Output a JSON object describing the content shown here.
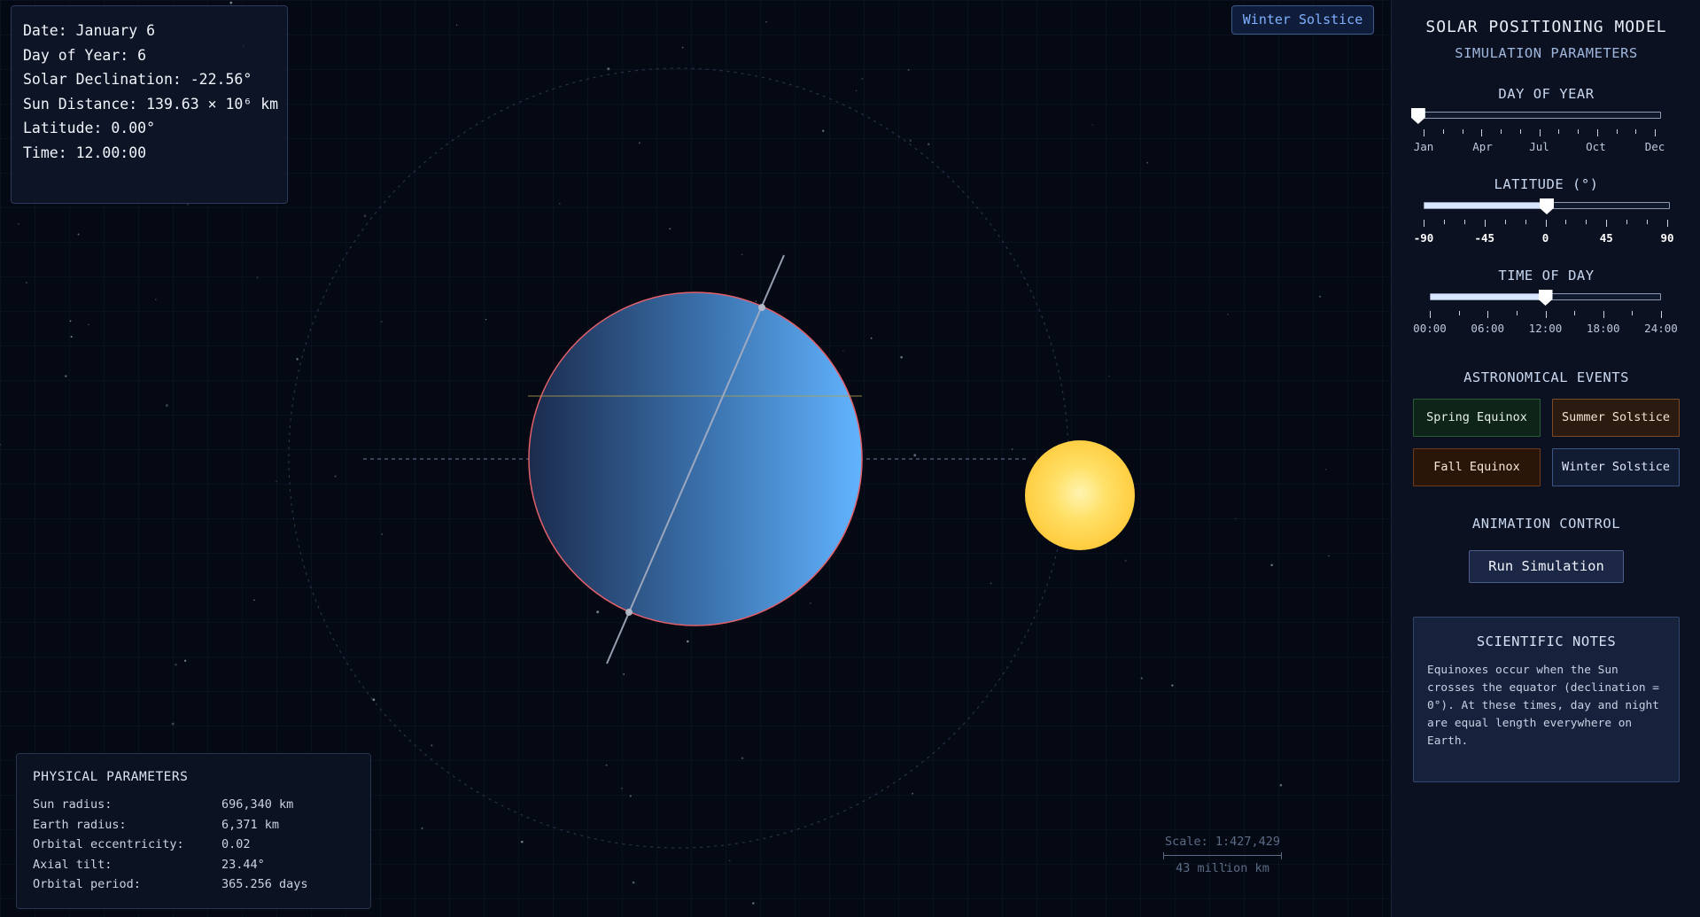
{
  "info": {
    "date": "Date: January 6",
    "day_of_year": "Day of Year: 6",
    "declination": "Solar Declination: -22.56°",
    "sun_distance": "Sun Distance: 139.63 × 10⁶ km",
    "latitude": "Latitude: 0.00°",
    "time": "Time: 12.00:00"
  },
  "event_badge": "Winter Solstice",
  "physical": {
    "title": "PHYSICAL PARAMETERS",
    "rows": [
      {
        "label": "Sun radius:",
        "value": "696,340 km"
      },
      {
        "label": "Earth radius:",
        "value": "6,371 km"
      },
      {
        "label": "Orbital eccentricity:",
        "value": "0.02"
      },
      {
        "label": "Axial tilt:",
        "value": "23.44°"
      },
      {
        "label": "Orbital period:",
        "value": "365.256 days"
      }
    ]
  },
  "scale": {
    "label": "Scale: 1:427,429",
    "distance": "43 million km"
  },
  "sidebar": {
    "title": "SOLAR POSITIONING MODEL",
    "subtitle": "SIMULATION PARAMETERS",
    "day_of_year": {
      "label": "DAY OF YEAR",
      "value": 6,
      "min": 1,
      "max": 365,
      "tick_labels": [
        "Jan",
        "Apr",
        "Jul",
        "Oct",
        "Dec"
      ]
    },
    "latitude": {
      "label": "LATITUDE (°)",
      "value": 0,
      "min": -90,
      "max": 90,
      "tick_labels": [
        "-90",
        "-45",
        "0",
        "45",
        "90"
      ]
    },
    "time_of_day": {
      "label": "TIME OF DAY",
      "value": 12,
      "min": 0,
      "max": 24,
      "tick_labels": [
        "00:00",
        "06:00",
        "12:00",
        "18:00",
        "24:00"
      ]
    },
    "events": {
      "label": "ASTRONOMICAL EVENTS",
      "spring": "Spring Equinox",
      "summer": "Summer Solstice",
      "fall": "Fall Equinox",
      "winter": "Winter Solstice"
    },
    "animation": {
      "label": "ANIMATION CONTROL",
      "run": "Run Simulation"
    },
    "notes": {
      "title": "SCIENTIFIC NOTES",
      "text": "Equinoxes occur when the Sun crosses the equator (declination = 0°). At these times, day and night are equal length everywhere on Earth."
    }
  },
  "colors": {
    "accent": "#7fb0ff",
    "sun": "#ffd24a",
    "earth_light": "#5fb2ff",
    "earth_dark": "#1b2b4d",
    "earth_outline": "#e0606b"
  }
}
